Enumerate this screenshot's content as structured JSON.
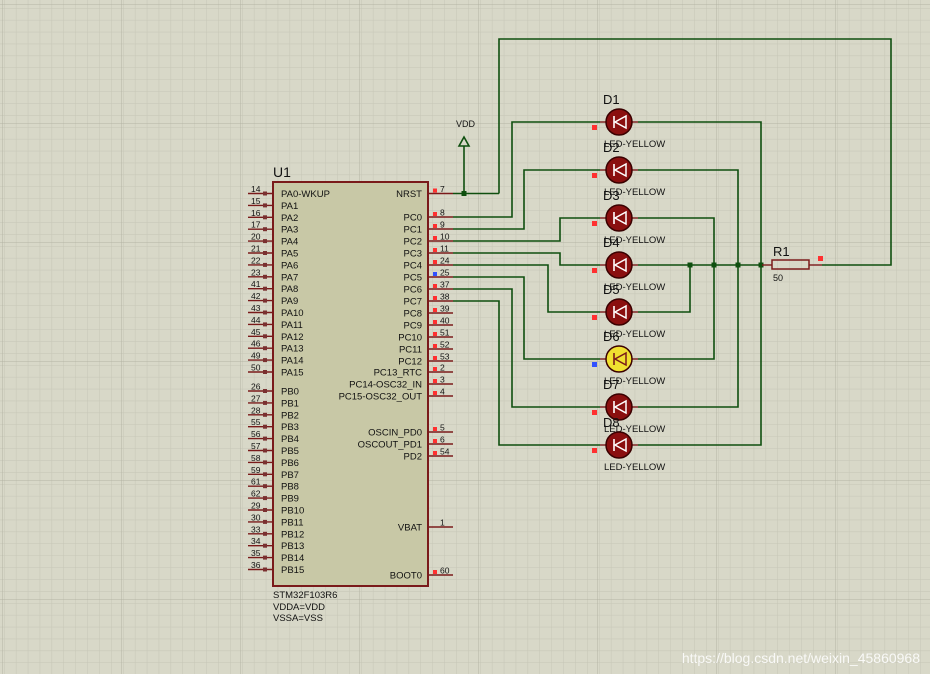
{
  "colors": {
    "background": "#d8d8c8",
    "grid_minor": "#c9c9b9",
    "grid_major": "#b6b6a6",
    "wire": "#0f4f0f",
    "chip_fill": "#c8c8a6",
    "chip_border": "#7a1a1a",
    "pin": "#7a1a1a",
    "led_off": "#8a0f0f",
    "led_on": "#f0e030",
    "pin_red": "#ff3030",
    "pin_blue": "#3050ff"
  },
  "chip": {
    "ref": "U1",
    "part": "STM32F103R6",
    "note1": "VDDA=VDD",
    "note2": "VSSA=VSS",
    "left_pins": [
      {
        "num": "14",
        "name": "PA0-WKUP"
      },
      {
        "num": "15",
        "name": "PA1"
      },
      {
        "num": "16",
        "name": "PA2"
      },
      {
        "num": "17",
        "name": "PA3"
      },
      {
        "num": "20",
        "name": "PA4"
      },
      {
        "num": "21",
        "name": "PA5"
      },
      {
        "num": "22",
        "name": "PA6"
      },
      {
        "num": "23",
        "name": "PA7"
      },
      {
        "num": "41",
        "name": "PA8"
      },
      {
        "num": "42",
        "name": "PA9"
      },
      {
        "num": "43",
        "name": "PA10"
      },
      {
        "num": "44",
        "name": "PA11"
      },
      {
        "num": "45",
        "name": "PA12"
      },
      {
        "num": "46",
        "name": "PA13"
      },
      {
        "num": "49",
        "name": "PA14"
      },
      {
        "num": "50",
        "name": "PA15"
      },
      {
        "num": "26",
        "name": "PB0"
      },
      {
        "num": "27",
        "name": "PB1"
      },
      {
        "num": "28",
        "name": "PB2"
      },
      {
        "num": "55",
        "name": "PB3"
      },
      {
        "num": "56",
        "name": "PB4"
      },
      {
        "num": "57",
        "name": "PB5"
      },
      {
        "num": "58",
        "name": "PB6"
      },
      {
        "num": "59",
        "name": "PB7"
      },
      {
        "num": "61",
        "name": "PB8"
      },
      {
        "num": "62",
        "name": "PB9"
      },
      {
        "num": "29",
        "name": "PB10"
      },
      {
        "num": "30",
        "name": "PB11"
      },
      {
        "num": "33",
        "name": "PB12"
      },
      {
        "num": "34",
        "name": "PB13"
      },
      {
        "num": "35",
        "name": "PB14"
      },
      {
        "num": "36",
        "name": "PB15"
      }
    ],
    "right_pins": [
      {
        "num": "7",
        "name": "NRST"
      },
      {
        "num": "8",
        "name": "PC0"
      },
      {
        "num": "9",
        "name": "PC1"
      },
      {
        "num": "10",
        "name": "PC2"
      },
      {
        "num": "11",
        "name": "PC3"
      },
      {
        "num": "24",
        "name": "PC4"
      },
      {
        "num": "25",
        "name": "PC5"
      },
      {
        "num": "37",
        "name": "PC6"
      },
      {
        "num": "38",
        "name": "PC7"
      },
      {
        "num": "39",
        "name": "PC8"
      },
      {
        "num": "40",
        "name": "PC9"
      },
      {
        "num": "51",
        "name": "PC10"
      },
      {
        "num": "52",
        "name": "PC11"
      },
      {
        "num": "53",
        "name": "PC12"
      },
      {
        "num": "2",
        "name": "PC13_RTC"
      },
      {
        "num": "3",
        "name": "PC14-OSC32_IN"
      },
      {
        "num": "4",
        "name": "PC15-OSC32_OUT"
      },
      {
        "num": "5",
        "name": "OSCIN_PD0"
      },
      {
        "num": "6",
        "name": "OSCOUT_PD1"
      },
      {
        "num": "54",
        "name": "PD2"
      },
      {
        "num": "1",
        "name": "VBAT"
      },
      {
        "num": "60",
        "name": "BOOT0"
      }
    ]
  },
  "vdd_label": "VDD",
  "leds": [
    {
      "ref": "D1",
      "type": "LED-YELLOW",
      "lit": false
    },
    {
      "ref": "D2",
      "type": "LED-YELLOW",
      "lit": false
    },
    {
      "ref": "D3",
      "type": "LED-YELLOW",
      "lit": false
    },
    {
      "ref": "D4",
      "type": "LED-YELLOW",
      "lit": false
    },
    {
      "ref": "D5",
      "type": "LED-YELLOW",
      "lit": false
    },
    {
      "ref": "D6",
      "type": "LED-YELLOW",
      "lit": true
    },
    {
      "ref": "D7",
      "type": "LED-YELLOW",
      "lit": false
    },
    {
      "ref": "D8",
      "type": "LED-YELLOW",
      "lit": false
    }
  ],
  "resistor": {
    "ref": "R1",
    "value": "50"
  },
  "watermark": "https://blog.csdn.net/weixin_45860968"
}
